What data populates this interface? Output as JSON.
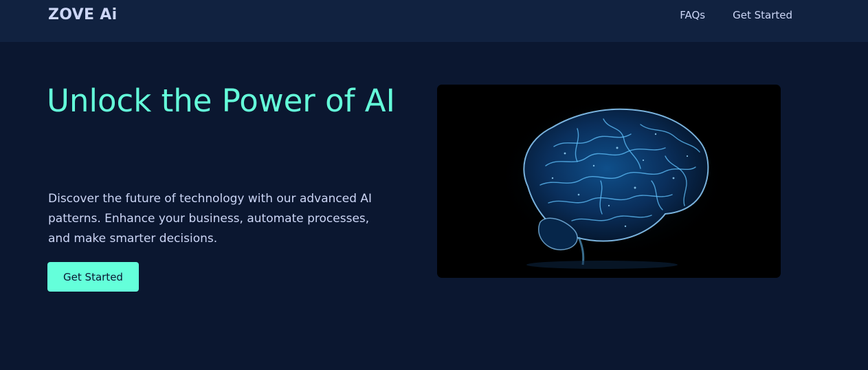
{
  "nav": {
    "logo": "ZOVE Ai",
    "links": [
      {
        "label": "FAQs"
      },
      {
        "label": "Get Started"
      }
    ]
  },
  "hero": {
    "title": "Unlock the Power of AI",
    "description": "Discover the future of technology with our advanced AI patterns. Enhance your business, automate processes, and make smarter decisions.",
    "cta_label": "Get Started",
    "image_subject": "glowing-blue-brain"
  },
  "colors": {
    "background": "#0b1730",
    "navbar": "#112240",
    "accent": "#64ffda",
    "text": "#ccd6f6",
    "image_background": "#000000"
  }
}
